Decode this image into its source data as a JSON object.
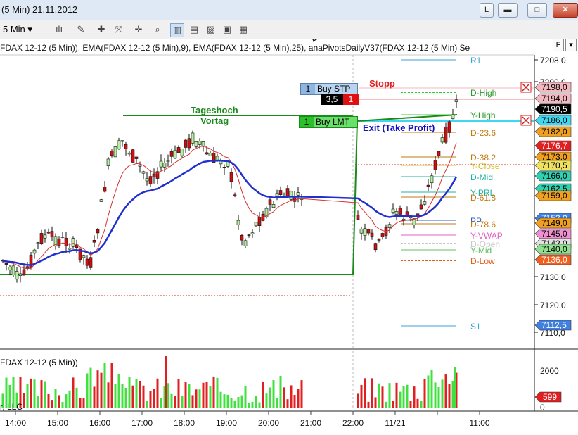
{
  "window": {
    "title": "(5 Min)  21.11.2012",
    "btn_link": "L",
    "btn_min": "▬",
    "btn_max": "□",
    "btn_close": "✕"
  },
  "toolbar": {
    "interval": "5 Min",
    "interval_arrow": "▾"
  },
  "caption": "FDAX  12-12  (5 Min)),  EMA(FDAX  12-12  (5 Min),9),  EMA(FDAX  12-12  (5 Min),25),  anaPivotsDailyV37(FDAX  12-12  (5 Min) Se",
  "caption_button": "F",
  "volume_caption": "FDAX  12-12 (5 Min))",
  "footer_fragment": "r, LLC",
  "annotations": {
    "tageshoch": "Tageshoch",
    "vortag": "Vortag",
    "stopp": "Stopp",
    "exit": "Exit (Take Profit)"
  },
  "orders": {
    "buy_stp": {
      "qty": "1",
      "label": "Buy STP"
    },
    "buy_stp_sub": {
      "value": "3,5",
      "qty": "1"
    },
    "buy_lmt": {
      "qty": "1",
      "label": "Buy LMT"
    }
  },
  "price_axis": [
    "7208,0",
    "7200,0",
    "7130,0",
    "7120,0",
    "7110,0"
  ],
  "time_axis": [
    "14:00",
    "15:00",
    "16:00",
    "17:00",
    "18:00",
    "19:00",
    "20:00",
    "21:00",
    "22:00",
    "11/21",
    "11:00"
  ],
  "volume_axis": [
    "2000",
    "0"
  ],
  "pivot_labels": [
    {
      "text": "R1",
      "color": "#3aa0d8"
    },
    {
      "text": "D-High",
      "color": "#2a9a2a"
    },
    {
      "text": "Y-High",
      "color": "#2a9a2a"
    },
    {
      "text": "D-23.6",
      "color": "#c07a10"
    },
    {
      "text": "D-38.2",
      "color": "#c07a10"
    },
    {
      "text": "Y-Close",
      "color": "#d8c020"
    },
    {
      "text": "D-Mid",
      "color": "#20b0a0"
    },
    {
      "text": "Y-PRL",
      "color": "#20b0a0"
    },
    {
      "text": "D-61.8",
      "color": "#c07a10"
    },
    {
      "text": "PP",
      "color": "#3060c0"
    },
    {
      "text": "D-78.6",
      "color": "#c07a10"
    },
    {
      "text": "Y-VWAP",
      "color": "#e060c0"
    },
    {
      "text": "D-Open",
      "color": "#c8c8c8"
    },
    {
      "text": "Y-Mid",
      "color": "#60c060"
    },
    {
      "text": "D-Low",
      "color": "#e06020"
    },
    {
      "text": "S1",
      "color": "#3aa0d8"
    }
  ],
  "price_tags": [
    {
      "text": "7198,0",
      "bg": "#f4b8c0",
      "fg": "#000"
    },
    {
      "text": "7194,0",
      "bg": "#f4b8c0",
      "fg": "#000"
    },
    {
      "text": "7190,5",
      "bg": "#000000",
      "fg": "#fff"
    },
    {
      "text": "7186,0",
      "bg": "#40d8f0",
      "fg": "#000"
    },
    {
      "text": "7182,0",
      "bg": "#f0a020",
      "fg": "#000"
    },
    {
      "text": "7176,7",
      "bg": "#e02020",
      "fg": "#fff"
    },
    {
      "text": "7173,0",
      "bg": "#f0a020",
      "fg": "#000"
    },
    {
      "text": "7170,5",
      "bg": "#f0e060",
      "fg": "#000"
    },
    {
      "text": "7166,0",
      "bg": "#30d0b0",
      "fg": "#000"
    },
    {
      "text": "7162,5",
      "bg": "#30d0b0",
      "fg": "#000"
    },
    {
      "text": "7159,0",
      "bg": "#f0a020",
      "fg": "#000"
    },
    {
      "text": "7152,0",
      "bg": "#4080e0",
      "fg": "#fff"
    },
    {
      "text": "7149,0",
      "bg": "#f0a020",
      "fg": "#000"
    },
    {
      "text": "7145,0",
      "bg": "#f090d0",
      "fg": "#000"
    },
    {
      "text": "7142,0",
      "bg": "#e0e0e0",
      "fg": "#000"
    },
    {
      "text": "7140,0",
      "bg": "#90e090",
      "fg": "#000"
    },
    {
      "text": "7136,0",
      "bg": "#f06020",
      "fg": "#fff"
    },
    {
      "text": "7112,5",
      "bg": "#4080e0",
      "fg": "#fff"
    }
  ],
  "volume_tag": {
    "text": "599",
    "bg": "#e02020",
    "fg": "#fff"
  },
  "colors": {
    "up_candle": "#b8f0a0",
    "down_candle": "#d01010",
    "ema_fast": "#d83030",
    "ema_slow": "#2030d0",
    "range_line": "#1a8a1a"
  }
}
